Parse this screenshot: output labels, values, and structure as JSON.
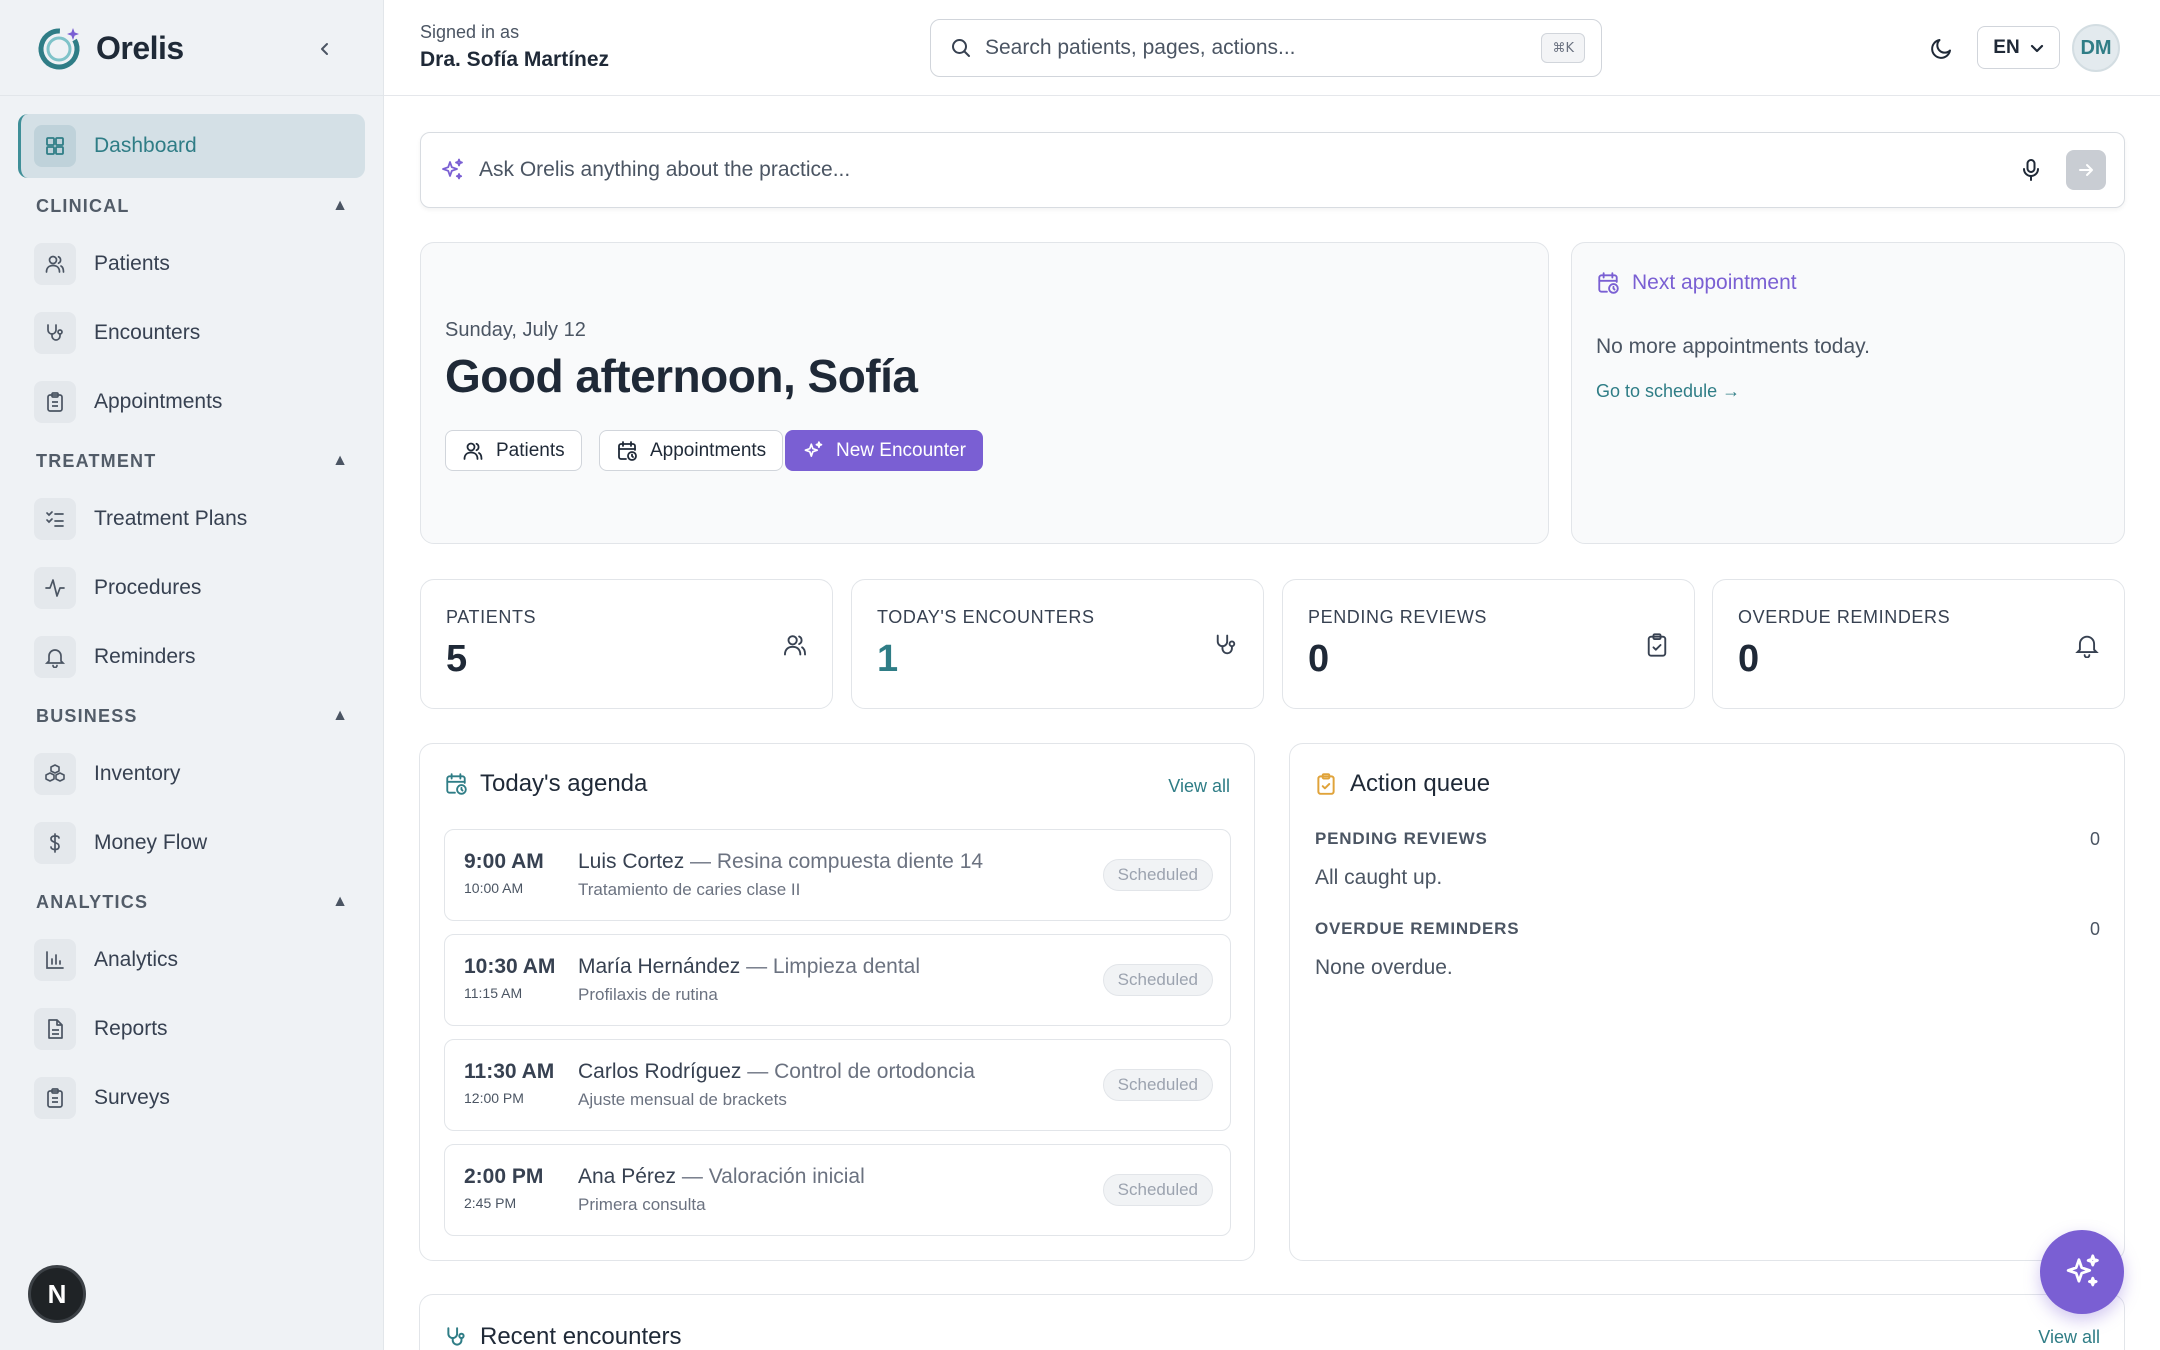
{
  "brand": {
    "name": "Orelis"
  },
  "sidebar": {
    "dashboard": "Dashboard",
    "sections": {
      "clinical": {
        "label": "CLINICAL",
        "caret": "▲",
        "items": [
          "Patients",
          "Encounters",
          "Appointments"
        ]
      },
      "treatment": {
        "label": "TREATMENT",
        "caret": "▲",
        "items": [
          "Treatment Plans",
          "Procedures",
          "Reminders"
        ]
      },
      "business": {
        "label": "BUSINESS",
        "caret": "▲",
        "items": [
          "Inventory",
          "Money Flow"
        ]
      },
      "analytics": {
        "label": "ANALYTICS",
        "caret": "▲",
        "items": [
          "Analytics",
          "Reports",
          "Surveys"
        ]
      }
    },
    "user_initial": "N"
  },
  "header": {
    "signed_in_label": "Signed in as",
    "user_name": "Dra. Sofía Martínez",
    "search_placeholder": "Search patients, pages, actions...",
    "shortcut": "⌘K",
    "language": "EN",
    "avatar_initials": "DM"
  },
  "ask": {
    "placeholder": "Ask Orelis anything about the practice..."
  },
  "hero": {
    "date": "Sunday, July 12",
    "greeting": "Good afternoon, Sofía",
    "buttons": {
      "patients": "Patients",
      "appointments": "Appointments",
      "new_encounter": "New Encounter"
    }
  },
  "next_appointment": {
    "title": "Next appointment",
    "message": "No more appointments today.",
    "link": "Go to schedule →"
  },
  "stats": [
    {
      "label": "PATIENTS",
      "value": "5",
      "icon": "users-icon"
    },
    {
      "label": "TODAY'S ENCOUNTERS",
      "value": "1",
      "icon": "stethoscope-icon"
    },
    {
      "label": "PENDING REVIEWS",
      "value": "0",
      "icon": "clipboard-check-icon"
    },
    {
      "label": "OVERDUE REMINDERS",
      "value": "0",
      "icon": "bell-icon"
    }
  ],
  "agenda": {
    "title": "Today's agenda",
    "view_all": "View all",
    "items": [
      {
        "start": "9:00 AM",
        "end": "10:00 AM",
        "patient": "Luis Cortez",
        "procedure": " — Resina compuesta diente 14",
        "note": "Tratamiento de caries clase II",
        "status": "Scheduled"
      },
      {
        "start": "10:30 AM",
        "end": "11:15 AM",
        "patient": "María Hernández",
        "procedure": " — Limpieza dental",
        "note": "Profilaxis de rutina",
        "status": "Scheduled"
      },
      {
        "start": "11:30 AM",
        "end": "12:00 PM",
        "patient": "Carlos Rodríguez",
        "procedure": " — Control de ortodoncia",
        "note": "Ajuste mensual de brackets",
        "status": "Scheduled"
      },
      {
        "start": "2:00 PM",
        "end": "2:45 PM",
        "patient": "Ana Pérez",
        "procedure": " — Valoración inicial",
        "note": "Primera consulta",
        "status": "Scheduled"
      }
    ]
  },
  "action_queue": {
    "title": "Action queue",
    "pending_label": "PENDING REVIEWS",
    "pending_count": "0",
    "pending_text": "All caught up.",
    "overdue_label": "OVERDUE REMINDERS",
    "overdue_count": "0",
    "overdue_text": "None overdue."
  },
  "recent": {
    "title": "Recent encounters",
    "view_all": "View all"
  },
  "colors": {
    "accent_teal": "#2f7d86",
    "accent_purple": "#7a5fd3"
  }
}
